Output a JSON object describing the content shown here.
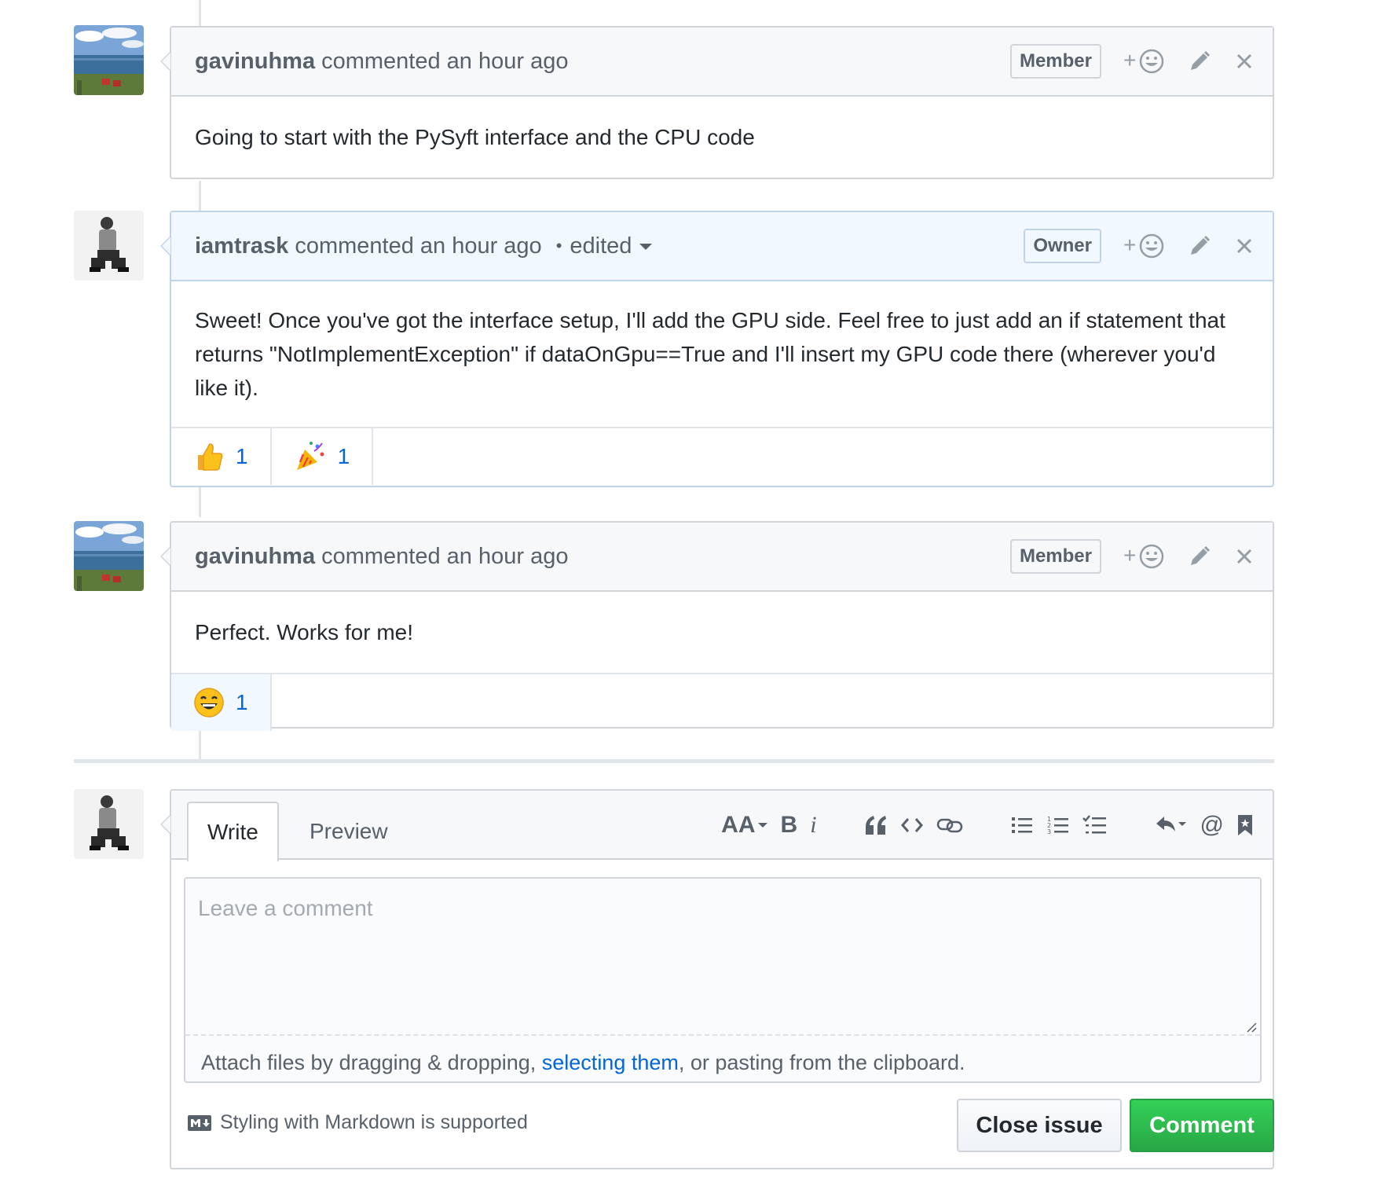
{
  "comments": [
    {
      "author": "gavinuhma",
      "meta": "commented an hour ago",
      "role": "Member",
      "body": "Going to start with the PySyft interface and the CPU code"
    },
    {
      "author": "iamtrask",
      "meta": "commented an hour ago",
      "edited_dot": "•",
      "edited": "edited",
      "role": "Owner",
      "body": "Sweet! Once you've got the interface setup, I'll add the GPU side. Feel free to just add an if statement that returns \"NotImplementException\" if dataOnGpu==True and I'll insert my GPU code there (wherever you'd like it).",
      "reactions": [
        {
          "emoji": "thumbs-up-emoji",
          "count": "1"
        },
        {
          "emoji": "tada-emoji",
          "count": "1"
        }
      ]
    },
    {
      "author": "gavinuhma",
      "meta": "commented an hour ago",
      "role": "Member",
      "body": "Perfect. Works for me!",
      "reactions": [
        {
          "emoji": "smile-emoji",
          "count": "1"
        }
      ]
    }
  ],
  "composer": {
    "tabs": [
      "Write",
      "Preview"
    ],
    "placeholder": "Leave a comment",
    "attach_prefix": "Attach files by dragging & dropping, ",
    "attach_link": "selecting them",
    "attach_suffix": ", or pasting from the clipboard.",
    "markdown_hint": "Styling with Markdown is supported",
    "close_label": "Close issue",
    "comment_label": "Comment",
    "toolbar": {
      "header": "AA",
      "bold": "B",
      "italic": "i",
      "mention": "@"
    }
  },
  "colors": {
    "link": "#0366d6",
    "green": "#28a745",
    "border": "#d1d5da",
    "owner_header": "#f1f8ff"
  }
}
